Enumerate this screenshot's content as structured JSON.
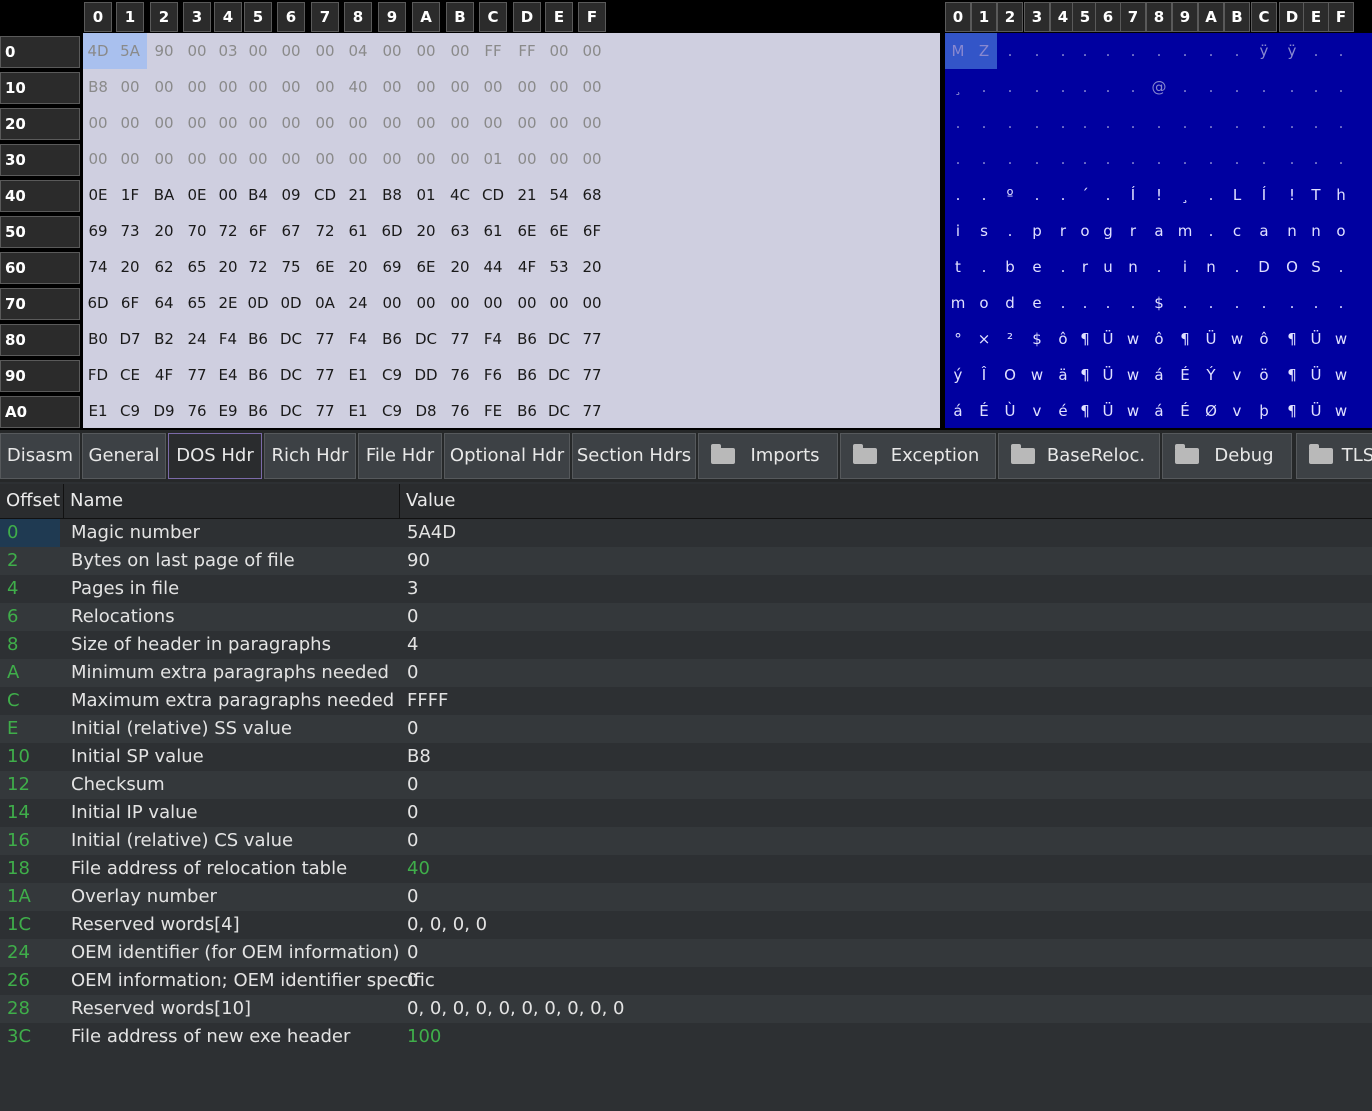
{
  "hex_view": {
    "columns": [
      "0",
      "1",
      "2",
      "3",
      "4",
      "5",
      "6",
      "7",
      "8",
      "9",
      "A",
      "B",
      "C",
      "D",
      "E",
      "F"
    ],
    "rows": [
      {
        "addr": "0",
        "bytes": [
          "4D",
          "5A",
          "90",
          "00",
          "03",
          "00",
          "00",
          "00",
          "04",
          "00",
          "00",
          "00",
          "FF",
          "FF",
          "00",
          "00"
        ],
        "ascii": [
          "M",
          "Z",
          ".",
          ".",
          ".",
          ".",
          ".",
          ".",
          ".",
          ".",
          ".",
          ".",
          "ÿ",
          "ÿ",
          ".",
          "."
        ],
        "dim": true
      },
      {
        "addr": "10",
        "bytes": [
          "B8",
          "00",
          "00",
          "00",
          "00",
          "00",
          "00",
          "00",
          "40",
          "00",
          "00",
          "00",
          "00",
          "00",
          "00",
          "00"
        ],
        "ascii": [
          "¸",
          ".",
          ".",
          ".",
          ".",
          ".",
          ".",
          ".",
          "@",
          ".",
          ".",
          ".",
          ".",
          ".",
          ".",
          "."
        ],
        "dim": true
      },
      {
        "addr": "20",
        "bytes": [
          "00",
          "00",
          "00",
          "00",
          "00",
          "00",
          "00",
          "00",
          "00",
          "00",
          "00",
          "00",
          "00",
          "00",
          "00",
          "00"
        ],
        "ascii": [
          ".",
          ".",
          ".",
          ".",
          ".",
          ".",
          ".",
          ".",
          ".",
          ".",
          ".",
          ".",
          ".",
          ".",
          ".",
          "."
        ],
        "dim": true
      },
      {
        "addr": "30",
        "bytes": [
          "00",
          "00",
          "00",
          "00",
          "00",
          "00",
          "00",
          "00",
          "00",
          "00",
          "00",
          "00",
          "01",
          "00",
          "00",
          "00"
        ],
        "ascii": [
          ".",
          ".",
          ".",
          ".",
          ".",
          ".",
          ".",
          ".",
          ".",
          ".",
          ".",
          ".",
          ".",
          ".",
          ".",
          "."
        ],
        "dim": true
      },
      {
        "addr": "40",
        "bytes": [
          "0E",
          "1F",
          "BA",
          "0E",
          "00",
          "B4",
          "09",
          "CD",
          "21",
          "B8",
          "01",
          "4C",
          "CD",
          "21",
          "54",
          "68"
        ],
        "ascii": [
          ".",
          ".",
          "º",
          ".",
          ".",
          "´",
          ".",
          "Í",
          "!",
          "¸",
          ".",
          "L",
          "Í",
          "!",
          "T",
          "h"
        ],
        "dim": false
      },
      {
        "addr": "50",
        "bytes": [
          "69",
          "73",
          "20",
          "70",
          "72",
          "6F",
          "67",
          "72",
          "61",
          "6D",
          "20",
          "63",
          "61",
          "6E",
          "6E",
          "6F"
        ],
        "ascii": [
          "i",
          "s",
          ".",
          "p",
          "r",
          "o",
          "g",
          "r",
          "a",
          "m",
          ".",
          "c",
          "a",
          "n",
          "n",
          "o"
        ],
        "dim": false
      },
      {
        "addr": "60",
        "bytes": [
          "74",
          "20",
          "62",
          "65",
          "20",
          "72",
          "75",
          "6E",
          "20",
          "69",
          "6E",
          "20",
          "44",
          "4F",
          "53",
          "20"
        ],
        "ascii": [
          "t",
          ".",
          "b",
          "e",
          ".",
          "r",
          "u",
          "n",
          ".",
          "i",
          "n",
          ".",
          "D",
          "O",
          "S",
          "."
        ],
        "dim": false
      },
      {
        "addr": "70",
        "bytes": [
          "6D",
          "6F",
          "64",
          "65",
          "2E",
          "0D",
          "0D",
          "0A",
          "24",
          "00",
          "00",
          "00",
          "00",
          "00",
          "00",
          "00"
        ],
        "ascii": [
          "m",
          "o",
          "d",
          "e",
          ".",
          ".",
          ".",
          ".",
          "$",
          ".",
          ".",
          ".",
          ".",
          ".",
          ".",
          "."
        ],
        "dim": false
      },
      {
        "addr": "80",
        "bytes": [
          "B0",
          "D7",
          "B2",
          "24",
          "F4",
          "B6",
          "DC",
          "77",
          "F4",
          "B6",
          "DC",
          "77",
          "F4",
          "B6",
          "DC",
          "77"
        ],
        "ascii": [
          "°",
          "×",
          "²",
          "$",
          "ô",
          "¶",
          "Ü",
          "w",
          "ô",
          "¶",
          "Ü",
          "w",
          "ô",
          "¶",
          "Ü",
          "w"
        ],
        "dim": false
      },
      {
        "addr": "90",
        "bytes": [
          "FD",
          "CE",
          "4F",
          "77",
          "E4",
          "B6",
          "DC",
          "77",
          "E1",
          "C9",
          "DD",
          "76",
          "F6",
          "B6",
          "DC",
          "77"
        ],
        "ascii": [
          "ý",
          "Î",
          "O",
          "w",
          "ä",
          "¶",
          "Ü",
          "w",
          "á",
          "É",
          "Ý",
          "v",
          "ö",
          "¶",
          "Ü",
          "w"
        ],
        "dim": false
      },
      {
        "addr": "A0",
        "bytes": [
          "E1",
          "C9",
          "D9",
          "76",
          "E9",
          "B6",
          "DC",
          "77",
          "E1",
          "C9",
          "D8",
          "76",
          "FE",
          "B6",
          "DC",
          "77"
        ],
        "ascii": [
          "á",
          "É",
          "Ù",
          "v",
          "é",
          "¶",
          "Ü",
          "w",
          "á",
          "É",
          "Ø",
          "v",
          "þ",
          "¶",
          "Ü",
          "w"
        ],
        "dim": false
      }
    ]
  },
  "tabs": [
    {
      "label": "Disasm",
      "folder": false,
      "active": false
    },
    {
      "label": "General",
      "folder": false,
      "active": false
    },
    {
      "label": "DOS Hdr",
      "folder": false,
      "active": true
    },
    {
      "label": "Rich Hdr",
      "folder": false,
      "active": false
    },
    {
      "label": "File Hdr",
      "folder": false,
      "active": false
    },
    {
      "label": "Optional Hdr",
      "folder": false,
      "active": false
    },
    {
      "label": "Section Hdrs",
      "folder": false,
      "active": false
    },
    {
      "label": "Imports",
      "folder": true,
      "active": false
    },
    {
      "label": "Exception",
      "folder": true,
      "active": false
    },
    {
      "label": "BaseReloc.",
      "folder": true,
      "active": false
    },
    {
      "label": "Debug",
      "folder": true,
      "active": false
    },
    {
      "label": "TLS",
      "folder": true,
      "active": false
    }
  ],
  "table": {
    "headers": {
      "offset": "Offset",
      "name": "Name",
      "value": "Value"
    },
    "rows": [
      {
        "offset": "0",
        "name": "Magic number",
        "value": "5A4D",
        "link": false
      },
      {
        "offset": "2",
        "name": "Bytes on last page of file",
        "value": "90",
        "link": false
      },
      {
        "offset": "4",
        "name": "Pages in file",
        "value": "3",
        "link": false
      },
      {
        "offset": "6",
        "name": "Relocations",
        "value": "0",
        "link": false
      },
      {
        "offset": "8",
        "name": "Size of header in paragraphs",
        "value": "4",
        "link": false
      },
      {
        "offset": "A",
        "name": "Minimum extra paragraphs needed",
        "value": "0",
        "link": false
      },
      {
        "offset": "C",
        "name": "Maximum extra paragraphs needed",
        "value": "FFFF",
        "link": false
      },
      {
        "offset": "E",
        "name": "Initial (relative) SS value",
        "value": "0",
        "link": false
      },
      {
        "offset": "10",
        "name": "Initial SP value",
        "value": "B8",
        "link": false
      },
      {
        "offset": "12",
        "name": "Checksum",
        "value": "0",
        "link": false
      },
      {
        "offset": "14",
        "name": "Initial IP value",
        "value": "0",
        "link": false
      },
      {
        "offset": "16",
        "name": "Initial (relative) CS value",
        "value": "0",
        "link": false
      },
      {
        "offset": "18",
        "name": "File address of relocation table",
        "value": "40",
        "link": true
      },
      {
        "offset": "1A",
        "name": "Overlay number",
        "value": "0",
        "link": false
      },
      {
        "offset": "1C",
        "name": "Reserved words[4]",
        "value": "0, 0, 0, 0",
        "link": false
      },
      {
        "offset": "24",
        "name": "OEM identifier (for OEM information)",
        "value": "0",
        "link": false
      },
      {
        "offset": "26",
        "name": "OEM information; OEM identifier specific",
        "value": "0",
        "link": false
      },
      {
        "offset": "28",
        "name": "Reserved words[10]",
        "value": "0, 0, 0, 0, 0, 0, 0, 0, 0, 0",
        "link": false
      },
      {
        "offset": "3C",
        "name": "File address of new exe header",
        "value": "100",
        "link": true
      }
    ]
  },
  "colors": {
    "accent_green": "#3fae4a",
    "ascii_bg": "#0000a0",
    "hex_bg": "#cfcfe0",
    "selection": "#a9c0ee"
  }
}
